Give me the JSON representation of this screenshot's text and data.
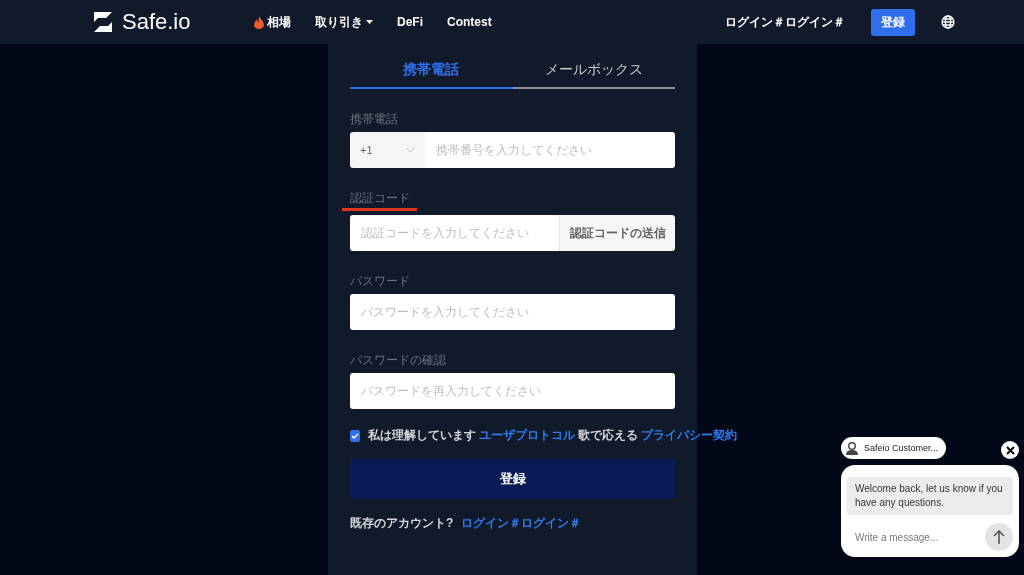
{
  "header": {
    "logo": "Safe.io",
    "nav": [
      {
        "label": "相場",
        "kind": "hot"
      },
      {
        "label": "取り引き",
        "kind": "dropdown"
      },
      {
        "label": "DeFi",
        "kind": "plain"
      },
      {
        "label": "Contest",
        "kind": "plain"
      }
    ],
    "login": "ログイン＃ログイン＃",
    "register": "登録"
  },
  "tabs": [
    {
      "label": "携帯電話",
      "selected": true
    },
    {
      "label": "メールボックス",
      "selected": false
    }
  ],
  "fields": [
    {
      "label": "携帯電話",
      "kind": "phone",
      "country_code": "+1",
      "placeholder": "携帯番号を入力してください",
      "marked": false
    },
    {
      "label": "認証コード",
      "kind": "code",
      "placeholder": "認証コードを入力してください",
      "button": "認証コードの送信",
      "marked": true
    },
    {
      "label": "パスワード",
      "kind": "text",
      "placeholder": "パスワードを入力してください",
      "marked": false
    },
    {
      "label": "パスワードの確認",
      "kind": "text",
      "placeholder": "パスワードを再入力してください",
      "marked": false
    }
  ],
  "agreement": {
    "checked": true,
    "parts": [
      {
        "text": "私は理解しています",
        "kind": "text"
      },
      {
        "text": "ユーザプロトコル",
        "kind": "link"
      },
      {
        "text": "歌で応える",
        "kind": "text"
      },
      {
        "text": "プライバシー契約",
        "kind": "link"
      }
    ]
  },
  "submit": "登録",
  "existing": {
    "text": "既存のアカウント?",
    "link": "ログイン＃ログイン＃"
  },
  "chat": {
    "agent": "Safeio Customer...",
    "message": "Welcome back, let us know if you have any questions.",
    "placeholder": "Write a message..."
  }
}
